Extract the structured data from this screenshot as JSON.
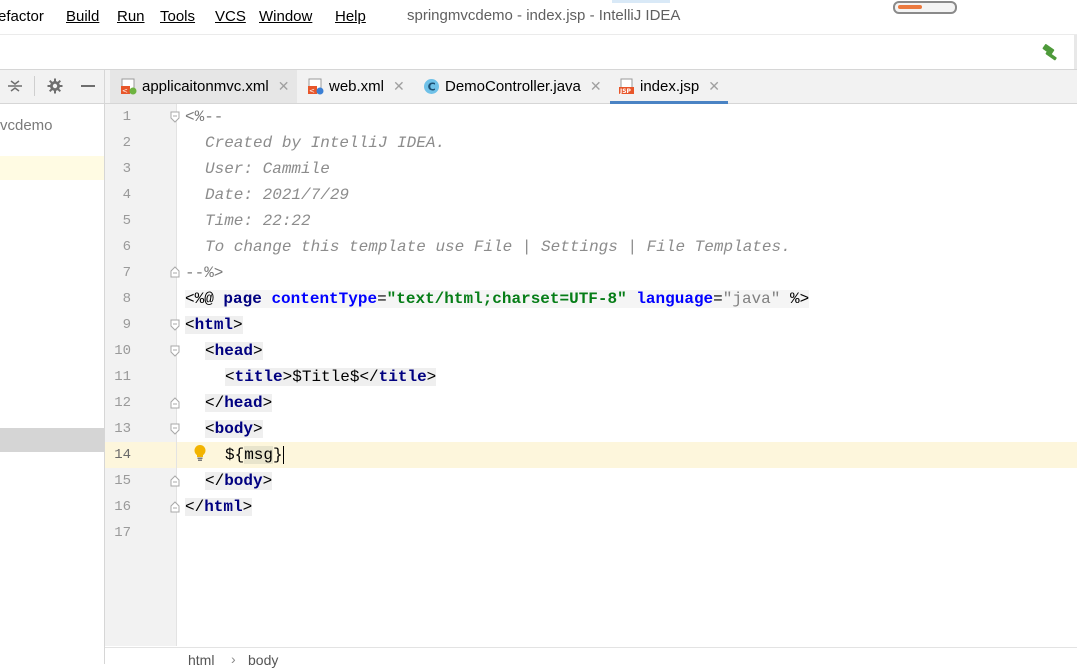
{
  "window": {
    "title": "springmvcdemo - index.jsp - IntelliJ IDEA",
    "memory_fill_fraction": 0.45
  },
  "menu": [
    {
      "key": "refactor",
      "label": "efactor"
    },
    {
      "key": "build",
      "label": "Build"
    },
    {
      "key": "run",
      "label": "Run"
    },
    {
      "key": "tools",
      "label": "Tools"
    },
    {
      "key": "vcs",
      "label": "VCS"
    },
    {
      "key": "window",
      "label": "Window"
    },
    {
      "key": "help",
      "label": "Help"
    }
  ],
  "toolbar": {
    "build_icon": "hammer-icon",
    "build_color": "#4e9a3a"
  },
  "project_panel": {
    "icons": [
      "collapse-all-icon",
      "gear-icon",
      "hide-icon"
    ],
    "root_label": "vcdemo"
  },
  "tabs": [
    {
      "label": "applicaitonmvc.xml",
      "icon": "spring-xml-file-icon",
      "active": false
    },
    {
      "label": "web.xml",
      "icon": "spring-xml-file-icon",
      "active": false
    },
    {
      "label": "DemoController.java",
      "icon": "class-icon",
      "active": false
    },
    {
      "label": "index.jsp",
      "icon": "jsp-file-icon",
      "active": true
    }
  ],
  "editor": {
    "line_numbers": [
      "1",
      "2",
      "3",
      "4",
      "5",
      "6",
      "7",
      "8",
      "9",
      "10",
      "11",
      "12",
      "13",
      "14",
      "15",
      "16",
      "17"
    ],
    "current_line": "14",
    "comment": {
      "open": "<%--",
      "created": "Created by IntelliJ IDEA.",
      "user": "User: Cammile",
      "date": "Date: 2021/7/29",
      "time": "Time: 22:22",
      "hint": "To change this template use File | Settings | File Templates.",
      "close": "--%>"
    },
    "directive": {
      "open": "<%@",
      "name": "page",
      "attr1": "contentType",
      "eq1": "=",
      "val1": "\"text/html;charset=UTF-8\"",
      "attr2": "language",
      "eq2": "=",
      "val2": "\"java\"",
      "close": "%>"
    },
    "tags": {
      "html_open": "html",
      "head_open": "head",
      "title_open": "title",
      "title_text": "$Title$",
      "head_close": "head",
      "body_open": "body",
      "el_prefix": "${",
      "el_name": "msg",
      "el_suffix": "}",
      "body_close": "body",
      "html_close": "html"
    }
  },
  "breadcrumb": {
    "items": [
      "html",
      "body"
    ]
  }
}
